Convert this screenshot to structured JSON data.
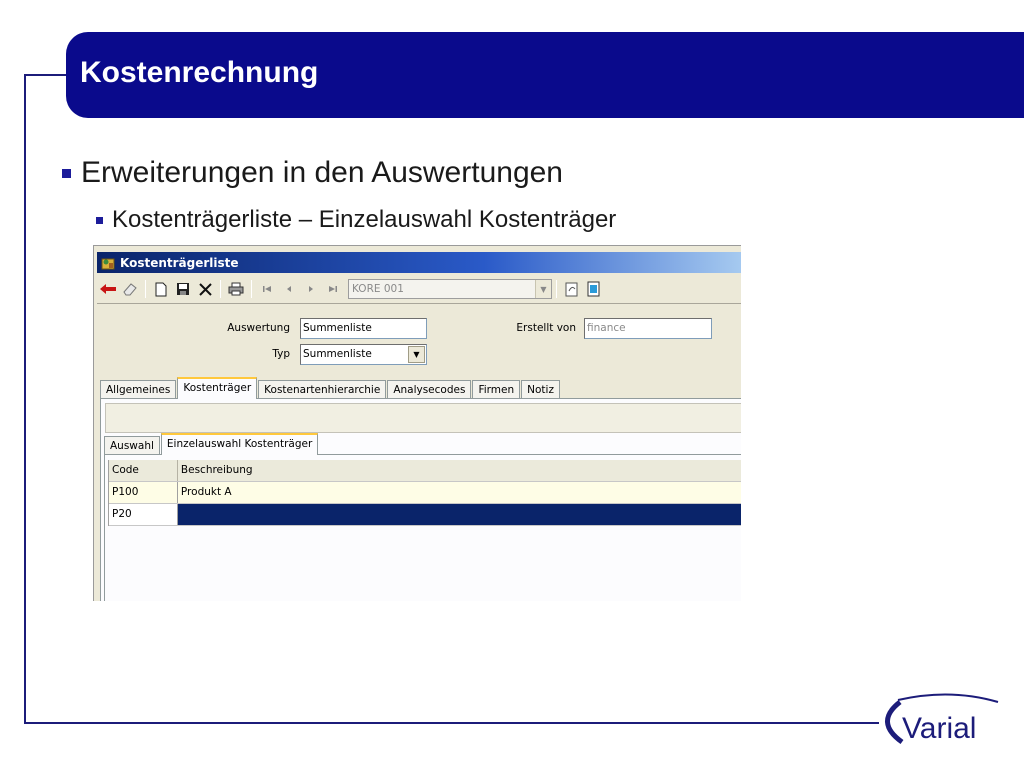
{
  "slide": {
    "title": "Kostenrechnung",
    "bullet_main": "Erweiterungen in den Auswertungen",
    "bullet_sub": "Kostenträgerliste – Einzelauswahl Kostenträger",
    "logo_text": "Varial",
    "colors": {
      "brand_blue": "#0a0a8c",
      "frame": "#1c1c7a"
    }
  },
  "window": {
    "title": "Kostenträgerliste",
    "toolbar": {
      "icons": [
        "back-arrow-icon",
        "eraser-icon",
        "new-document-icon",
        "save-icon",
        "delete-icon",
        "print-icon",
        "first-record-icon",
        "previous-record-icon",
        "next-record-icon",
        "last-record-icon",
        "refresh-icon",
        "notes-icon"
      ],
      "record_combo_value": "KORE 001"
    },
    "form": {
      "auswertung_label": "Auswertung",
      "auswertung_value": "Summenliste",
      "typ_label": "Typ",
      "typ_value": "Summenliste",
      "erstellt_von_label": "Erstellt von",
      "erstellt_von_value": "finance"
    },
    "tabs": [
      "Allgemeines",
      "Kostenträger",
      "Kostenartenhierarchie",
      "Analysecodes",
      "Firmen",
      "Notiz"
    ],
    "active_tab": "Kostenträger",
    "subtabs": [
      "Auswahl",
      "Einzelauswahl Kostenträger"
    ],
    "active_subtab": "Einzelauswahl Kostenträger",
    "grid": {
      "columns": [
        "Code",
        "Beschreibung"
      ],
      "rows": [
        {
          "code": "P100",
          "beschreibung": "Produkt A"
        },
        {
          "code": "P20",
          "beschreibung": ""
        }
      ]
    }
  }
}
